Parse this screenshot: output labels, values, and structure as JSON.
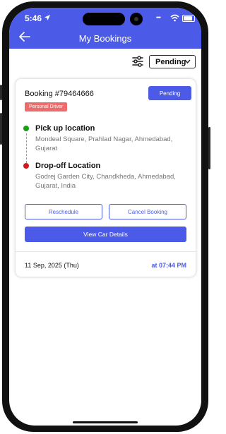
{
  "status_bar": {
    "time": "5:46",
    "signal": "••••"
  },
  "header": {
    "title": "My Bookings"
  },
  "filter": {
    "selected": "Pending"
  },
  "booking": {
    "id_label": "Booking #79464666",
    "status": "Pending",
    "tag": "Personal Driver",
    "pickup": {
      "title": "Pick up location",
      "address": "Mondeal Square, Prahlad Nagar, Ahmedabad, Gujarat"
    },
    "dropoff": {
      "title": "Drop-off Location",
      "address": "Godrej Garden City, Chandkheda, Ahmedabad, Gujarat, India"
    },
    "reschedule_label": "Reschedule",
    "cancel_label": "Cancel Booking",
    "view_label": "View Car Details",
    "date": "11 Sep, 2025 (Thu)",
    "time": "at 07:44 PM"
  },
  "colors": {
    "primary": "#4b5be8",
    "tag": "#ef6b6b",
    "pickup_dot": "#1a9e1a",
    "dropoff_dot": "#d11a1a"
  },
  "icons": [
    "location-arrow-icon",
    "wifi-icon",
    "battery-icon",
    "back-arrow-icon",
    "filter-sliders-icon",
    "chevron-down-icon"
  ]
}
